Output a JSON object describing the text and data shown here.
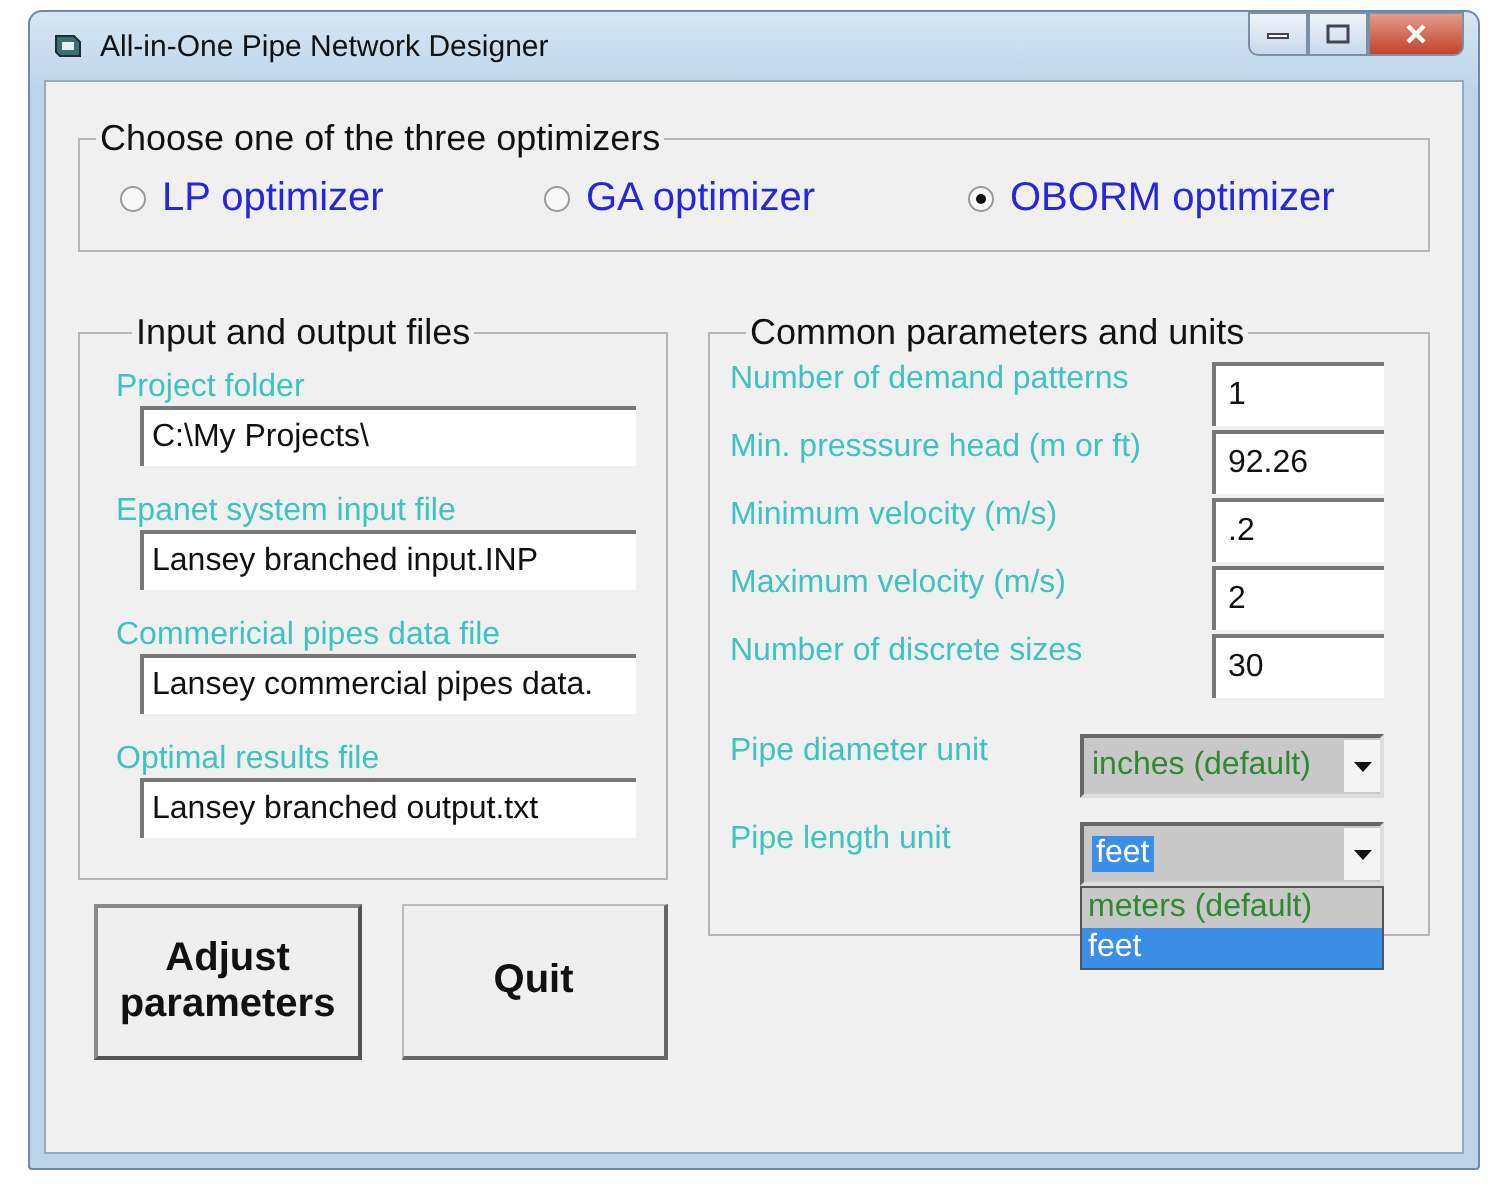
{
  "window": {
    "title": "All-in-One Pipe Network Designer"
  },
  "optimizers": {
    "legend": "Choose one of the three optimizers",
    "options": [
      {
        "label": "LP optimizer",
        "selected": false
      },
      {
        "label": "GA optimizer",
        "selected": false
      },
      {
        "label": "OBORM optimizer",
        "selected": true
      }
    ]
  },
  "files": {
    "legend": "Input and output files",
    "fields": [
      {
        "label": "Project folder",
        "value": "C:\\My Projects\\"
      },
      {
        "label": "Epanet system input file",
        "value": "Lansey branched input.INP"
      },
      {
        "label": "Commericial pipes data file",
        "value": "Lansey commercial pipes data."
      },
      {
        "label": "Optimal results file",
        "value": "Lansey branched output.txt"
      }
    ]
  },
  "params": {
    "legend": "Common parameters and units",
    "fields": [
      {
        "label": "Number of demand patterns",
        "value": "1"
      },
      {
        "label": "Min. presssure head (m or ft)",
        "value": "92.26"
      },
      {
        "label": "Minimum velocity (m/s)",
        "value": ".2"
      },
      {
        "label": "Maximum velocity (m/s)",
        "value": "2"
      },
      {
        "label": "Number of discrete sizes",
        "value": "30"
      }
    ],
    "dropdowns": [
      {
        "label": "Pipe diameter unit",
        "value": "inches (default)",
        "expanded": false
      },
      {
        "label": "Pipe length unit",
        "value": "feet",
        "expanded": true,
        "options": [
          {
            "label": "meters (default)",
            "selected": false
          },
          {
            "label": "feet",
            "selected": true
          }
        ]
      }
    ]
  },
  "buttons": [
    "Adjust parameters",
    "Quit"
  ]
}
